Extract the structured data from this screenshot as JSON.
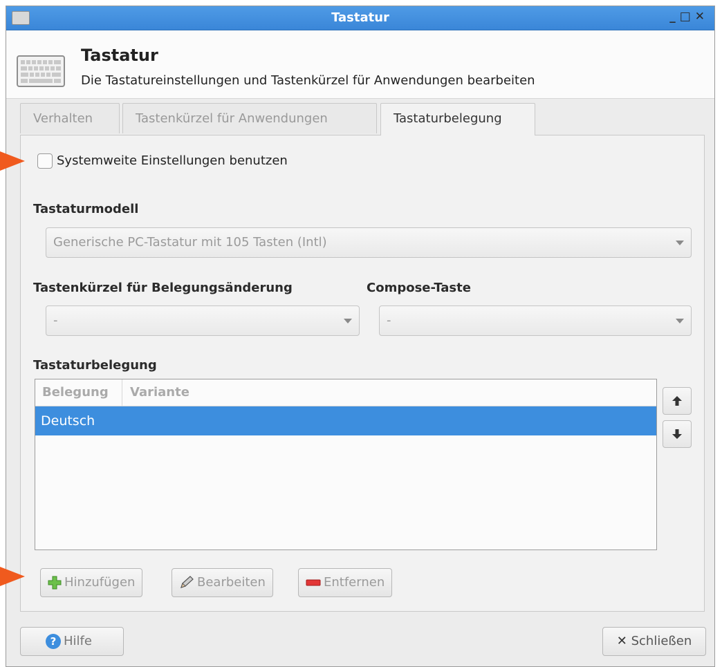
{
  "window": {
    "title": "Tastatur"
  },
  "header": {
    "title": "Tastatur",
    "subtitle": "Die Tastatureinstellungen und Tastenkürzel für Anwendungen bearbeiten"
  },
  "tabs": [
    {
      "label": "Verhalten",
      "active": false
    },
    {
      "label": "Tastenkürzel für Anwendungen",
      "active": false
    },
    {
      "label": "Tastaturbelegung",
      "active": true
    }
  ],
  "system_checkbox": {
    "label": "Systemweite Einstellungen benutzen",
    "checked": false
  },
  "model": {
    "section": "Tastaturmodell",
    "value": "Generische PC-Tastatur mit 105 Tasten (Intl)"
  },
  "switch_shortcut": {
    "section": "Tastenkürzel für Belegungsänderung",
    "value": "-"
  },
  "compose": {
    "section": "Compose-Taste",
    "value": "-"
  },
  "layout": {
    "section": "Tastaturbelegung",
    "columns": [
      "Belegung",
      "Variante"
    ],
    "rows": [
      {
        "layout": "Deutsch",
        "variant": "",
        "selected": true
      }
    ]
  },
  "buttons": {
    "add": "Hinzufügen",
    "edit": "Bearbeiten",
    "remove": "Entfernen",
    "help": "Hilfe",
    "close": "Schließen"
  },
  "colors": {
    "titlebar": "#3a86d8",
    "selection": "#3d8ede",
    "annotation": "#f05a1e"
  }
}
